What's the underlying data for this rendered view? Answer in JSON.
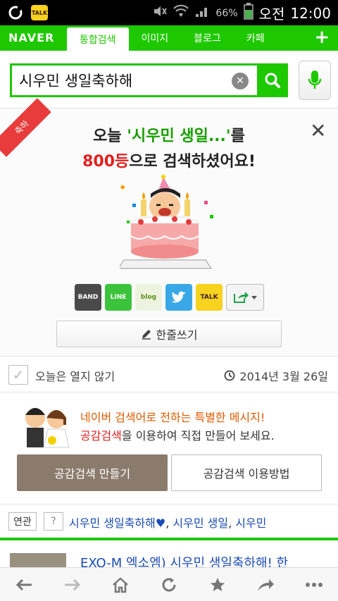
{
  "status": {
    "carrier_icon": "olleh-icon",
    "battery": "66%",
    "period": "오전",
    "time": "12:00",
    "kakao_badge": "TALK"
  },
  "nav": {
    "logo": "NAVER",
    "tabs": [
      "통합검색",
      "이미지",
      "블로그",
      "카페"
    ],
    "plus": "+"
  },
  "search": {
    "query": "시우민 생일축하해"
  },
  "celebrate": {
    "ribbon": "축하",
    "line1_pre": "오늘 ",
    "line1_quote": "'시우민 생일...'",
    "line1_post": "를",
    "rank": "800등",
    "line2_post": "으로 검색하셨어요!",
    "share": [
      "BAND",
      "LINE",
      "blog",
      "",
      "TALK"
    ],
    "write_label": "한줄쓰기"
  },
  "options": {
    "dont_show": "오늘은 열지 않기",
    "date": "2014년 3월 26일"
  },
  "empathy": {
    "line1": "네이버 검색어로 전하는 특별한 메시지!",
    "line2_hl": "공감검색",
    "line2_rest": "을 이용하여 직접 만들어 보세요.",
    "make_btn": "공감검색 만들기",
    "howto_btn": "공감검색 이용방법"
  },
  "related": {
    "tag": "연관",
    "help": "?",
    "items": [
      "시우민 생일축하해♥",
      "시우민 생일",
      "시우민"
    ]
  },
  "result": {
    "title": "EXO-M 엑소엠) 시우민 생일축하해! 한"
  },
  "colors": {
    "naver_green": "#1ec800",
    "accent_red": "#e02020",
    "button_brown": "#8b7b6c",
    "link_blue": "#1a4bb5"
  }
}
